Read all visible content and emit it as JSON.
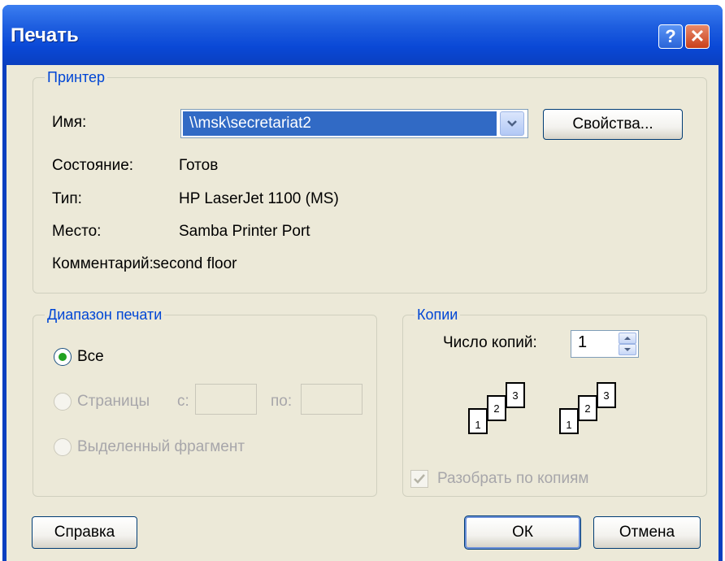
{
  "dialog": {
    "title": "Печать",
    "help_glyph": "?",
    "close_glyph": "✕"
  },
  "printer": {
    "legend": "Принтер",
    "name_label": "Имя:",
    "name_value": "\\\\msk\\secretariat2",
    "properties_button": "Свойства...",
    "status_label": "Состояние:",
    "status_value": "Готов",
    "type_label": "Тип:",
    "type_value": "HP LaserJet 1100 (MS)",
    "where_label": "Место:",
    "where_value": "Samba Printer Port",
    "comment_label": "Комментарий:",
    "comment_value": "second floor"
  },
  "range": {
    "legend": "Диапазон печати",
    "all": "Все",
    "pages": "Страницы",
    "from_label": "с:",
    "to_label": "по:",
    "selection": "Выделенный фрагмент"
  },
  "copies": {
    "legend": "Копии",
    "count_label": "Число копий:",
    "count_value": "1",
    "collate_label": "Разобрать по копиям",
    "page_numbers": [
      "1",
      "2",
      "3"
    ]
  },
  "buttons": {
    "help": "Справка",
    "ok": "ОК",
    "cancel": "Отмена"
  },
  "icons": [
    "help-icon",
    "close-icon",
    "chevron-down-icon",
    "spin-up-icon",
    "spin-down-icon",
    "checkmark-icon"
  ],
  "colors": {
    "titlebar": "#0a48d6",
    "dialog_bg": "#ece9d8",
    "legend": "#0046d5",
    "selection": "#316ac5",
    "radio_dot": "#21a121"
  }
}
